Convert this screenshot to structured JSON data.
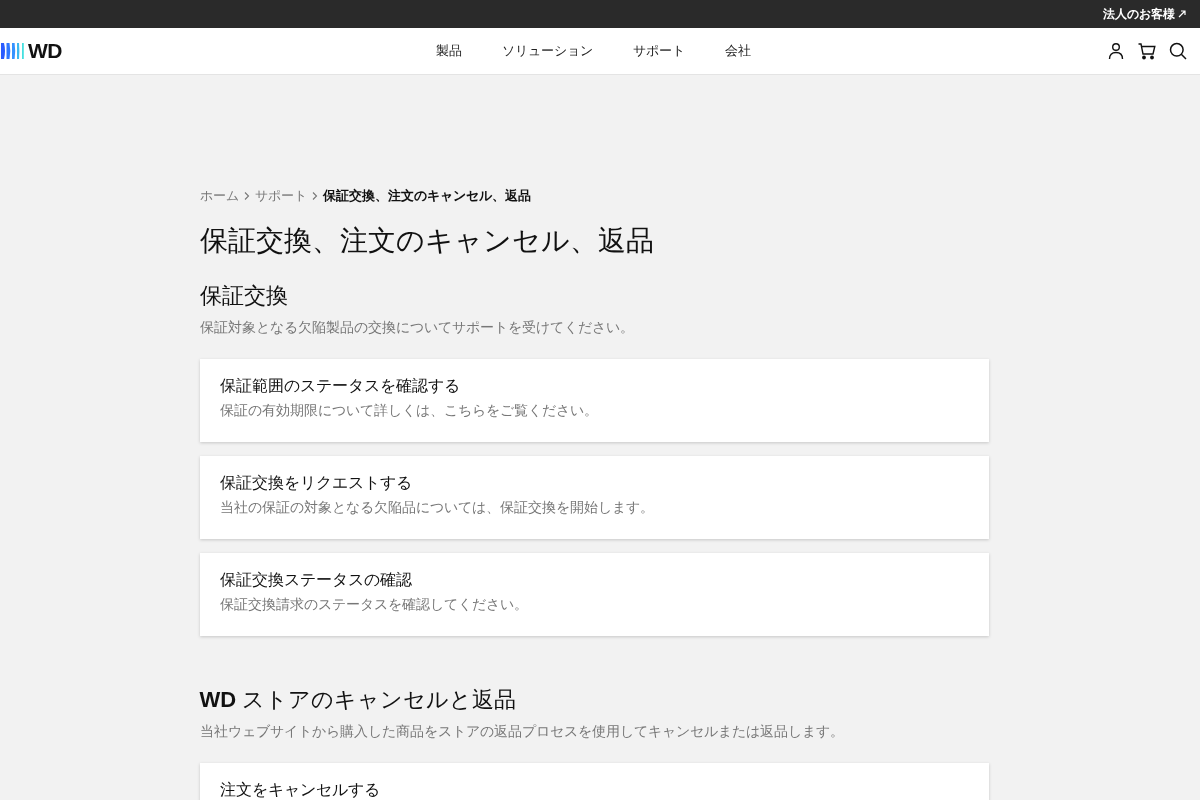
{
  "top_bar": {
    "link": "法人のお客様"
  },
  "header": {
    "logo": "WD",
    "nav": [
      {
        "label": "製品"
      },
      {
        "label": "ソリューション"
      },
      {
        "label": "サポート"
      },
      {
        "label": "会社"
      }
    ]
  },
  "breadcrumb": [
    {
      "label": "ホーム",
      "current": false
    },
    {
      "label": "サポート",
      "current": false
    },
    {
      "label": "保証交換、注文のキャンセル、返品",
      "current": true
    }
  ],
  "page_title": "保証交換、注文のキャンセル、返品",
  "sections": [
    {
      "heading": "保証交換",
      "description": "保証対象となる欠陥製品の交換についてサポートを受けてください。",
      "cards": [
        {
          "title": "保証範囲のステータスを確認する",
          "description": "保証の有効期限について詳しくは、こちらをご覧ください。"
        },
        {
          "title": "保証交換をリクエストする",
          "description": "当社の保証の対象となる欠陥品については、保証交換を開始します。"
        },
        {
          "title": "保証交換ステータスの確認",
          "description": "保証交換請求のステータスを確認してください。"
        }
      ]
    },
    {
      "heading": "**WD** ストアのキャンセルと返品",
      "description": "当社ウェブサイトから購入した商品をストアの返品プロセスを使用してキャンセルまたは返品します。",
      "cards": [
        {
          "title": "注文をキャンセルする"
        }
      ]
    }
  ]
}
